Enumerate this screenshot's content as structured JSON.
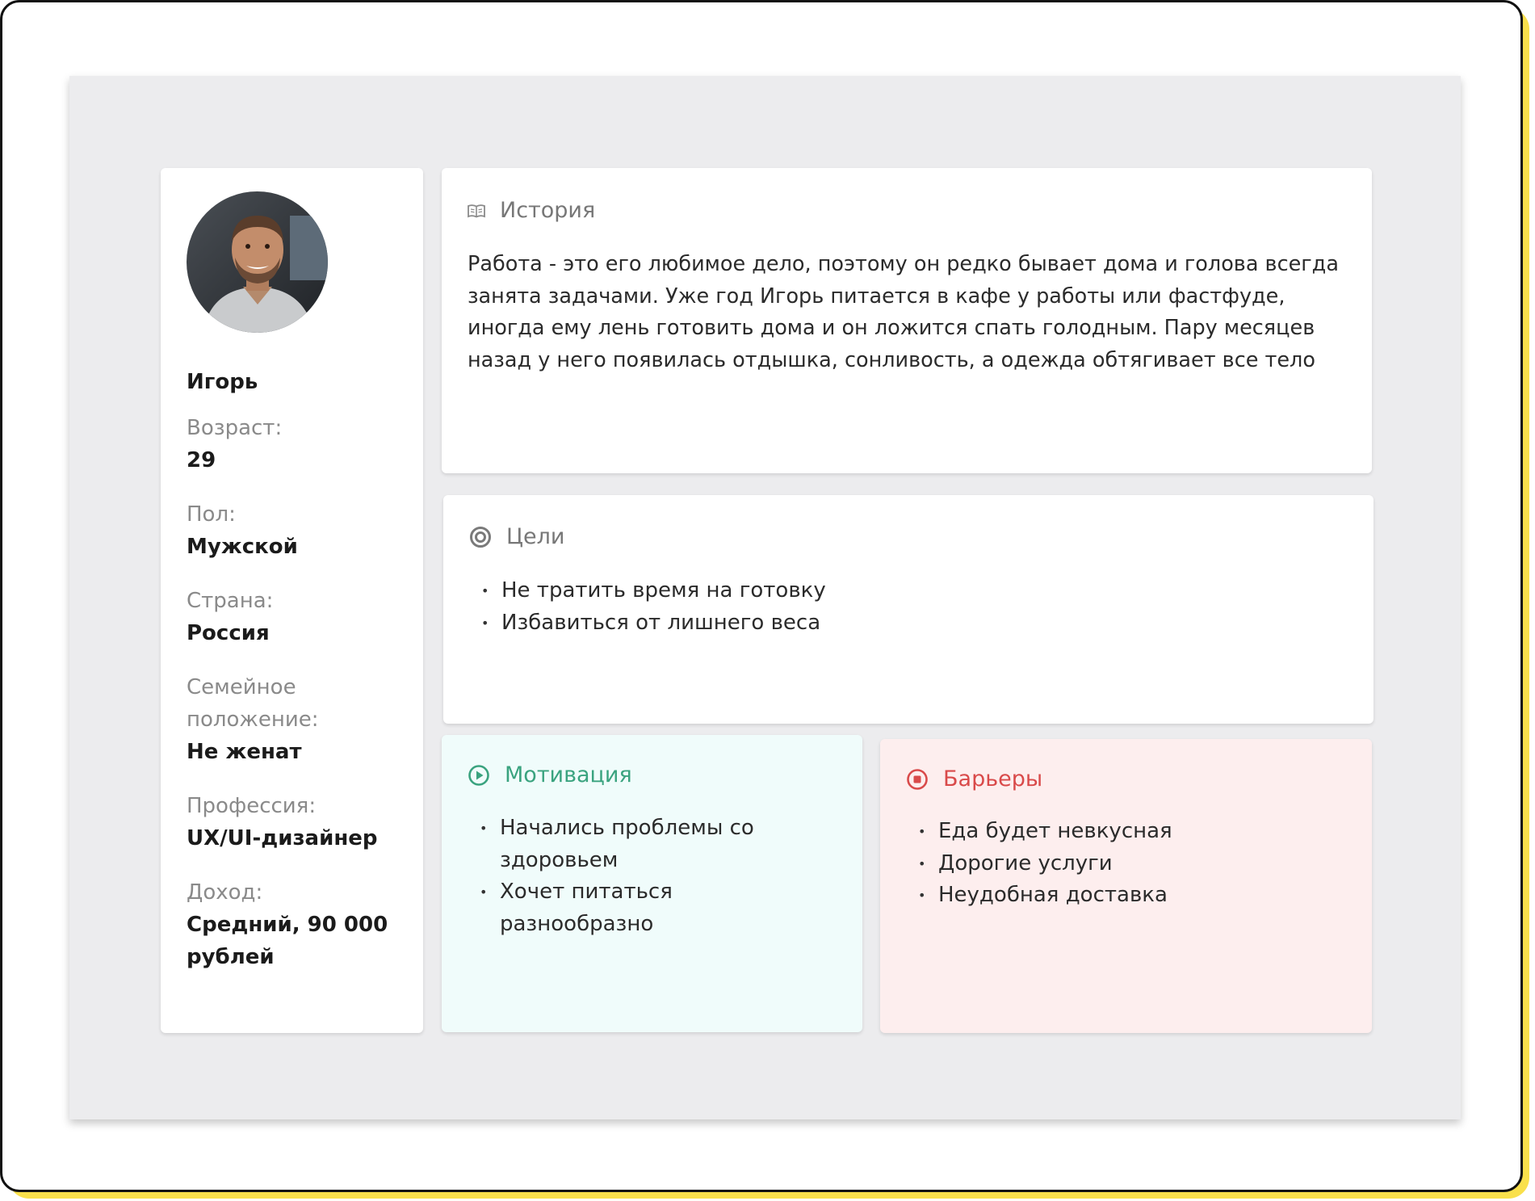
{
  "profile": {
    "name": "Игорь",
    "fields": [
      {
        "label": "Возраст:",
        "value": "29"
      },
      {
        "label": "Пол:",
        "value": "Мужской"
      },
      {
        "label": "Страна:",
        "value": "Россия"
      },
      {
        "label": "Семейное положение:",
        "value": "Не женат"
      },
      {
        "label": "Профессия:",
        "value": "UX/UI-дизайнер"
      },
      {
        "label": "Доход:",
        "value": "Средний, 90 000 рублей"
      }
    ]
  },
  "history": {
    "title": "История",
    "icon": "book-icon",
    "text": "Работа - это его любимое дело, поэтому он редко бывает дома и голова всегда занята задачами. Уже год Игорь питается в кафе у работы или фастфуде, иногда ему лень готовить дома и он ложится спать голодным. Пару месяцев назад у него появилась отдышка, сонливость, а одежда обтягивает все тело"
  },
  "goals": {
    "title": "Цели",
    "icon": "target-icon",
    "items": [
      "Не тратить время на готовку",
      "Избавиться от лишнего веса"
    ]
  },
  "motivation": {
    "title": "Мотивация",
    "icon": "play-circle-icon",
    "color": "#3aa37f",
    "background": "#f0fcfb",
    "items": [
      "Начались проблемы со здоровьем",
      "Хочет питаться разнообразно"
    ]
  },
  "barriers": {
    "title": "Барьеры",
    "icon": "stop-circle-icon",
    "color": "#d94a4a",
    "background": "#fdeeee",
    "items": [
      "Еда будет невкусная",
      "Дорогие услуги",
      "Неудобная доставка"
    ]
  }
}
